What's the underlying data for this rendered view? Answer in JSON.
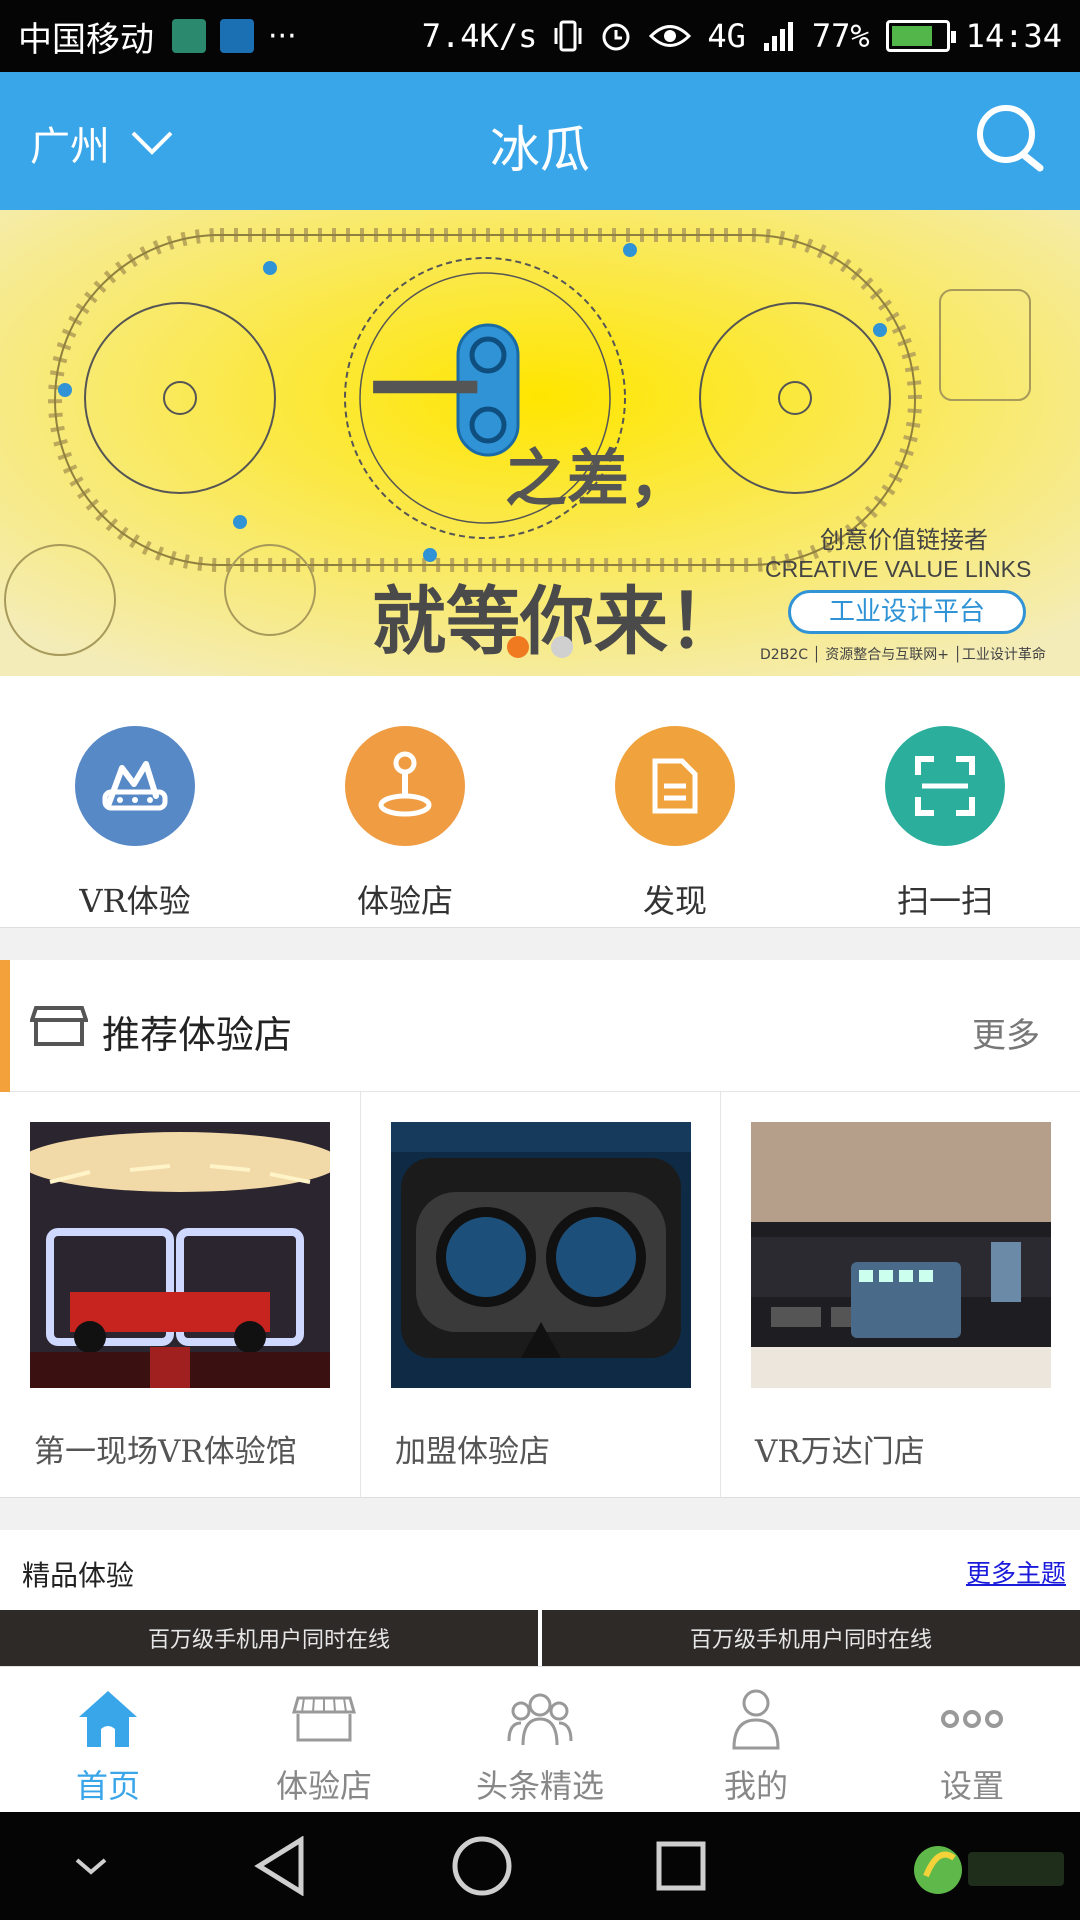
{
  "status_bar": {
    "carrier": "中国移动",
    "dots": "···",
    "speed": "7.4K/s",
    "network": "4G",
    "battery_percent": "77%",
    "battery_level": 0.77,
    "time": "14:34"
  },
  "header": {
    "city": "广州",
    "title": "冰瓜"
  },
  "banner": {
    "headline_prefix": "一",
    "headline_middle": "之差，",
    "headline_main": "就等你来！",
    "tagline_cn": "创意价值链接者",
    "tagline_en": "CREATIVE VALUE LINKS",
    "badge": "工业设计平台",
    "footer": "D2B2C │ 资源整合与互联网+ │工业设计革命",
    "page_count": 2,
    "active_page": 1
  },
  "quick_actions": [
    {
      "label": "VR体验",
      "icon": "vr-headset-icon",
      "color": "#5889c7"
    },
    {
      "label": "体验店",
      "icon": "location-person-icon",
      "color": "#ef9c43"
    },
    {
      "label": "发现",
      "icon": "document-icon",
      "color": "#f0a23c"
    },
    {
      "label": "扫一扫",
      "icon": "scan-icon",
      "color": "#2cae9c"
    }
  ],
  "recommended": {
    "title": "推荐体验店",
    "more": "更多",
    "stores": [
      {
        "name": "第一现场VR体验馆"
      },
      {
        "name": "加盟体验店"
      },
      {
        "name": "VR万达门店"
      }
    ]
  },
  "featured": {
    "title": "精品体验",
    "more": "更多主题",
    "cards": [
      {
        "caption": "百万级手机用户同时在线"
      },
      {
        "caption": "百万级手机用户同时在线"
      }
    ]
  },
  "bottom_nav": [
    {
      "label": "首页",
      "icon": "home-icon",
      "active": true
    },
    {
      "label": "体验店",
      "icon": "store-icon",
      "active": false
    },
    {
      "label": "头条精选",
      "icon": "group-icon",
      "active": false
    },
    {
      "label": "我的",
      "icon": "person-icon",
      "active": false
    },
    {
      "label": "设置",
      "icon": "more-dots-icon",
      "active": false
    }
  ],
  "colors": {
    "primary": "#3aa6ea",
    "accent": "#f3a13a"
  }
}
